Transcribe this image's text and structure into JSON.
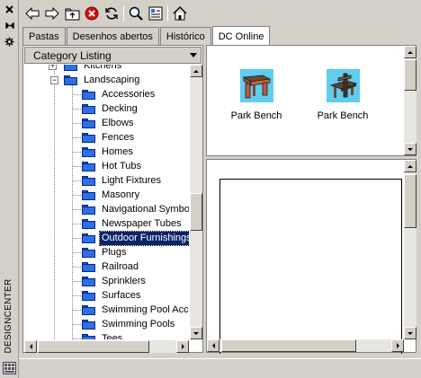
{
  "sidebar": {
    "title": "DESIGNCENTER",
    "close_icon": "close-icon",
    "autohide_icon": "autohide-icon",
    "properties_icon": "properties-icon"
  },
  "toolbar": {
    "icons": [
      "back-icon",
      "forward-icon",
      "up-icon",
      "stop-icon",
      "reload-icon",
      "search-icon",
      "favorites-icon",
      "home-icon"
    ]
  },
  "tabs": [
    {
      "label": "Pastas",
      "active": false
    },
    {
      "label": "Desenhos abertos",
      "active": false
    },
    {
      "label": "Histórico",
      "active": false
    },
    {
      "label": "DC Online",
      "active": true
    }
  ],
  "tree": {
    "dropdown_value": "Category Listing",
    "parent_partial": "Kitchens",
    "parent": "Landscaping",
    "children": [
      "Accessories",
      "Decking",
      "Elbows",
      "Fences",
      "Homes",
      "Hot Tubs",
      "Light Fixtures",
      "Masonry",
      "Navigational Symbol",
      "Newspaper Tubes",
      "Outdoor Furnishings",
      "Plugs",
      "Railroad",
      "Sprinklers",
      "Surfaces",
      "Swimming Pool Acces",
      "Swimming Pools",
      "Tees"
    ],
    "selected": "Outdoor Furnishings"
  },
  "content": {
    "items": [
      {
        "label": "Park Bench",
        "color": "#5ecdee"
      },
      {
        "label": "Park Bench",
        "color": "#5ecdee"
      }
    ]
  },
  "colors": {
    "selection": "#0a246a",
    "folder": "#2f6fe6",
    "thumb_bg": "#5ecdee"
  }
}
